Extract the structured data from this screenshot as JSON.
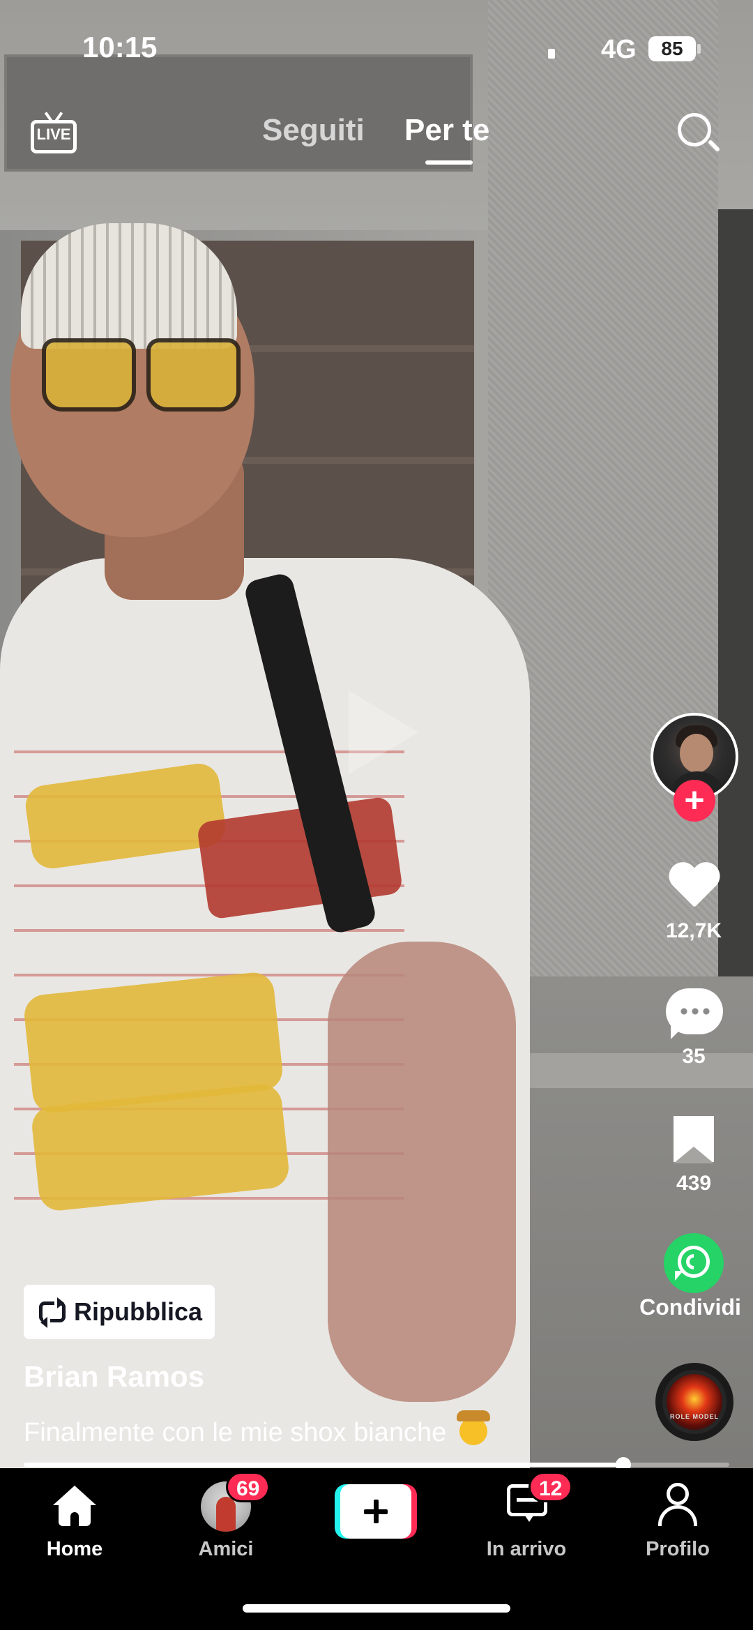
{
  "status_bar": {
    "time": "10:15",
    "network": "4G",
    "battery": "85"
  },
  "top_nav": {
    "live_label": "LIVE",
    "tabs": [
      {
        "label": "Seguiti",
        "active": false
      },
      {
        "label": "Per te",
        "active": true
      }
    ]
  },
  "video": {
    "author": "Brian Ramos",
    "caption": "Finalmente con le mie shox bianche",
    "caption_emoji": "cowboy-face-emoji",
    "repost_label": "Ripubblica",
    "progress_fraction": 0.85
  },
  "right_rail": {
    "likes": "12,7K",
    "comments": "35",
    "bookmarks": "439",
    "share_label": "Condividi",
    "music_disc_text": "ROLE MODEL"
  },
  "bottom_nav": {
    "items": [
      {
        "label": "Home",
        "icon": "home-icon",
        "active": true
      },
      {
        "label": "Amici",
        "icon": "friends-avatar",
        "badge": "69"
      },
      {
        "label": "",
        "icon": "create-icon"
      },
      {
        "label": "In arrivo",
        "icon": "inbox-icon",
        "badge": "12"
      },
      {
        "label": "Profilo",
        "icon": "profile-icon"
      }
    ]
  },
  "colors": {
    "accent": "#fe2c55",
    "cyan": "#25f4ee",
    "share_green": "#25d366"
  }
}
